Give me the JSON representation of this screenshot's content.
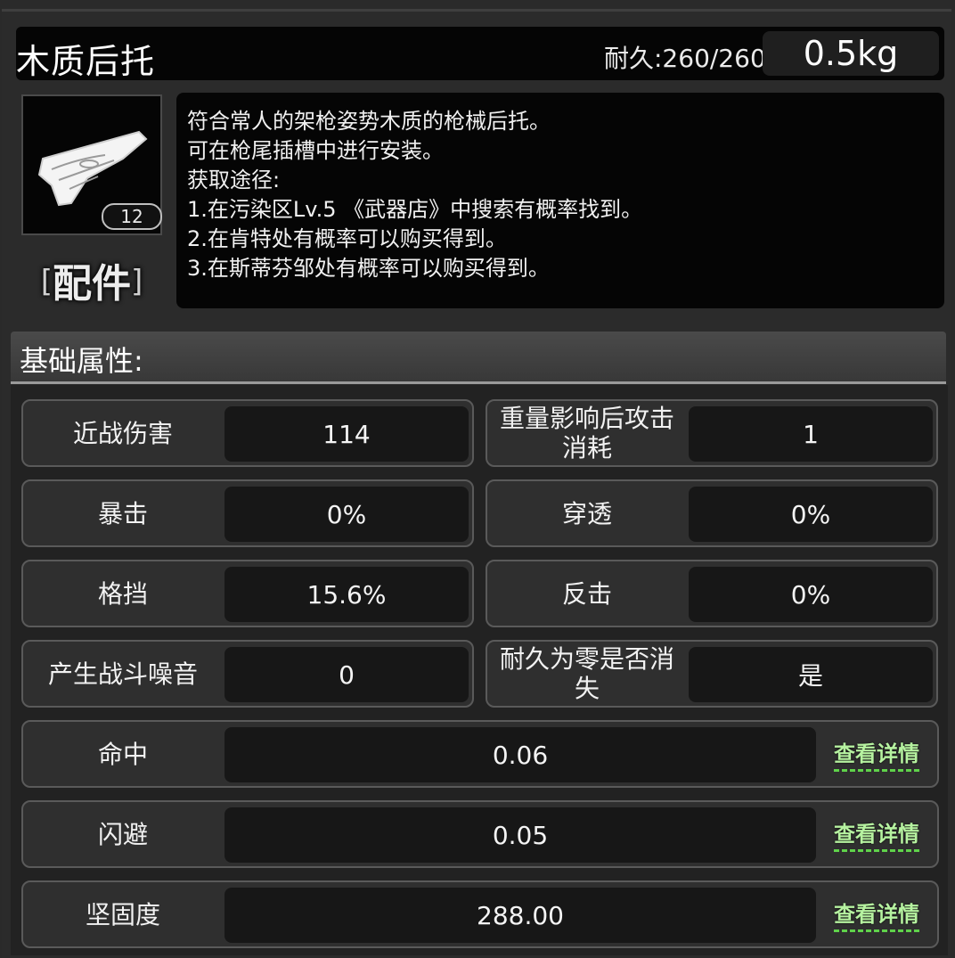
{
  "item": {
    "name": "木质后托",
    "durability": "耐久:260/260",
    "weight": "0.5kg",
    "count": "12",
    "icon": "wooden-stock-icon",
    "category_bracket_left": "[",
    "category": "配件",
    "category_bracket_right": "]"
  },
  "description": {
    "lines": [
      "符合常人的架枪姿势木质的枪械后托。",
      "可在枪尾插槽中进行安装。",
      "获取途径:",
      "1.在污染区Lv.5 《武器店》中搜索有概率找到。",
      "2.在肯特处有概率可以购买得到。",
      "3.在斯蒂芬邹处有概率可以购买得到。"
    ]
  },
  "section": {
    "title": "基础属性:"
  },
  "stats": [
    {
      "label": "近战伤害",
      "value": "114"
    },
    {
      "label": "重量影响后攻击\n消耗",
      "value": "1"
    },
    {
      "label": "暴击",
      "value": "0%"
    },
    {
      "label": "穿透",
      "value": "0%"
    },
    {
      "label": "格挡",
      "value": "15.6%"
    },
    {
      "label": "反击",
      "value": "0%"
    },
    {
      "label": "产生战斗噪音",
      "value": "0"
    },
    {
      "label": "耐久为零是否消\n失",
      "value": "是"
    }
  ],
  "detail_stats": [
    {
      "label": "命中",
      "value": "0.06",
      "link": "查看详情"
    },
    {
      "label": "闪避",
      "value": "0.05",
      "link": "查看详情"
    },
    {
      "label": "坚固度",
      "value": "288.00",
      "link": "查看详情"
    }
  ],
  "colors": {
    "link_text": "#b6f2a0",
    "link_underline": "#5fd24a",
    "panel_dark": "#050505"
  }
}
